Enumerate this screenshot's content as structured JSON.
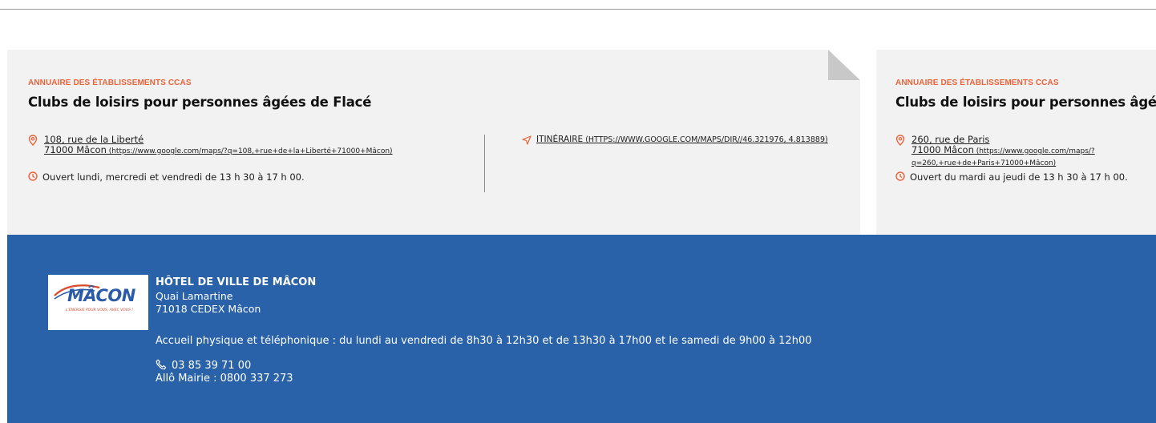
{
  "colors": {
    "accent": "#e8633a",
    "footer_bg": "#2962a8",
    "card_bg": "#f2f2f2"
  },
  "cards": [
    {
      "category": "ANNUAIRE DES ÉTABLISSEMENTS CCAS",
      "title": "Clubs de loisirs pour personnes âgées de Flacé",
      "address_line1": "108, rue de la Liberté ",
      "address_line2": "71000 Mâcon",
      "address_url": " (https://www.google.com/maps/?q=108,+rue+de+la+Liberté+71000+Mâcon)",
      "hours": "Ouvert lundi, mercredi et vendredi de 13 h 30 à 17 h 00.",
      "itinerary_label": "ITINÉRAIRE",
      "itinerary_url": " (HTTPS://WWW.GOOGLE.COM/MAPS/DIR//46.321976, 4.813889)"
    },
    {
      "category": "ANNUAIRE DES ÉTABLISSEMENTS CCAS",
      "title": "Clubs de loisirs pour personnes âgées",
      "address_line1": "260, rue de Paris ",
      "address_line2": "71000 Mâcon",
      "address_url": " (https://www.google.com/maps/?q=260,+rue+de+Paris+71000+Mâcon)",
      "hours": "Ouvert du mardi au jeudi de 13 h 30 à 17 h 00."
    }
  ],
  "footer": {
    "logo_text": "MÂCON",
    "logo_slogan": "L'ÉNERGIE POUR VOUS, AVEC VOUS !",
    "name": "HÔTEL DE VILLE DE MÂCON",
    "address_line1": "Quai Lamartine",
    "address_line2": "71018 CEDEX Mâcon",
    "hours": "Accueil physique et téléphonique : du lundi au vendredi de 8h30 à 12h30 et de 13h30 à 17h00 et le samedi de 9h00 à 12h00",
    "phone": "03 85 39 71 00",
    "allo": "Allô Mairie : 0800 337 273"
  }
}
